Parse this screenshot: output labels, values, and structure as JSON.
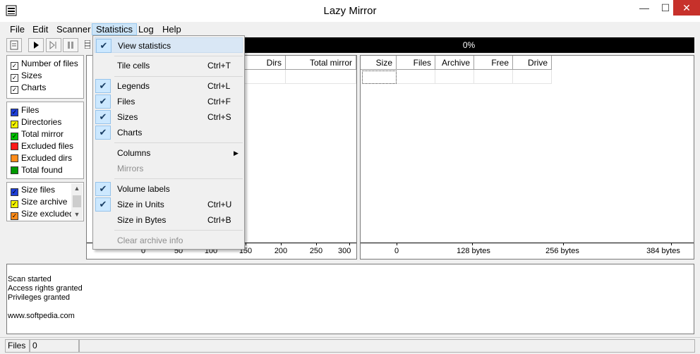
{
  "window": {
    "title": "Lazy Mirror",
    "minimize": "—",
    "maximize": "☐",
    "close": "✕"
  },
  "menubar": [
    "File",
    "Edit",
    "Scanner",
    "Statistics",
    "Log",
    "Help"
  ],
  "progress": {
    "label": "0%",
    "value": 0
  },
  "left_panel": {
    "options": [
      "Number of files",
      "Sizes",
      "Charts"
    ],
    "legend": [
      {
        "label": "Files",
        "color": "#1e3fd8"
      },
      {
        "label": "Directories",
        "color": "#f5f500"
      },
      {
        "label": "Total mirror",
        "color": "#00c000"
      },
      {
        "label": "Excluded files",
        "color": "#ff1a1a"
      },
      {
        "label": "Excluded dirs",
        "color": "#ff8c1a"
      },
      {
        "label": "Total found",
        "color": "#009900"
      }
    ],
    "size_legend": [
      {
        "label": "Size files",
        "color": "#1e3fd8"
      },
      {
        "label": "Size archive",
        "color": "#f5f500"
      },
      {
        "label": "Size excluded",
        "color": "#ff8c1a"
      }
    ]
  },
  "left_table": {
    "columns": [
      "Dirs",
      "Total mirror"
    ],
    "axis_labels": [
      "0",
      "50",
      "100",
      "150",
      "200",
      "250",
      "300"
    ]
  },
  "right_table": {
    "columns": [
      "Size",
      "Files",
      "Archive",
      "Free",
      "Drive"
    ],
    "axis_labels": [
      "0",
      "128 bytes",
      "256 bytes",
      "384 bytes"
    ]
  },
  "statistics_menu": {
    "view_statistics": "View statistics",
    "tile_cells": "Tile cells",
    "tile_cells_sc": "Ctrl+T",
    "legends": "Legends",
    "legends_sc": "Ctrl+L",
    "files": "Files",
    "files_sc": "Ctrl+F",
    "sizes": "Sizes",
    "sizes_sc": "Ctrl+S",
    "charts": "Charts",
    "columns": "Columns",
    "mirrors": "Mirrors",
    "volume_labels": "Volume labels",
    "size_units": "Size in Units",
    "size_units_sc": "Ctrl+U",
    "size_bytes": "Size in Bytes",
    "size_bytes_sc": "Ctrl+B",
    "clear_archive": "Clear archive info"
  },
  "log": [
    "Scan started",
    "Access rights granted",
    "Privileges granted",
    "www.softpedia.com"
  ],
  "statusbar": {
    "label": "Files",
    "value": "0"
  }
}
